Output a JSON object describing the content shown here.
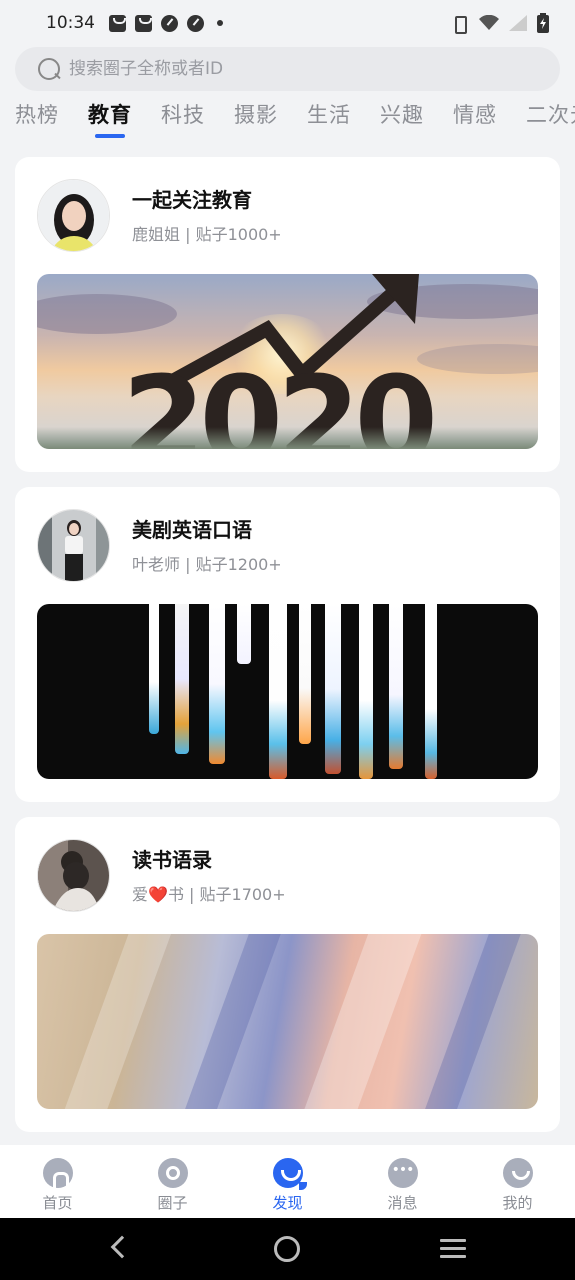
{
  "status_bar": {
    "time": "10:34"
  },
  "search": {
    "placeholder": "搜索圈子全称或者ID",
    "value": ""
  },
  "tabs": [
    {
      "label": "热榜",
      "active": false
    },
    {
      "label": "教育",
      "active": true
    },
    {
      "label": "科技",
      "active": false
    },
    {
      "label": "摄影",
      "active": false
    },
    {
      "label": "生活",
      "active": false
    },
    {
      "label": "兴趣",
      "active": false
    },
    {
      "label": "情感",
      "active": false
    },
    {
      "label": "二次元",
      "active": false
    }
  ],
  "cards": [
    {
      "title": "一起关注教育",
      "author": "鹿姐姐",
      "posts": "贴子1000+",
      "cover_text": "2020"
    },
    {
      "title": "美剧英语口语",
      "author": "叶老师",
      "posts": "贴子1200+"
    },
    {
      "title": "读书语录",
      "author_prefix": "爱",
      "author_heart": "❤️",
      "author_suffix": "书",
      "posts": "贴子1700+"
    }
  ],
  "bottom_nav": [
    {
      "label": "首页",
      "icon": "home-icon",
      "active": false
    },
    {
      "label": "圈子",
      "icon": "circle-icon",
      "active": false
    },
    {
      "label": "发现",
      "icon": "discover-icon",
      "active": true
    },
    {
      "label": "消息",
      "icon": "message-icon",
      "active": false
    },
    {
      "label": "我的",
      "icon": "me-icon",
      "active": false
    }
  ],
  "colors": {
    "accent": "#2a66f0",
    "background": "#f2f3f5",
    "muted_text": "#8f9197"
  }
}
